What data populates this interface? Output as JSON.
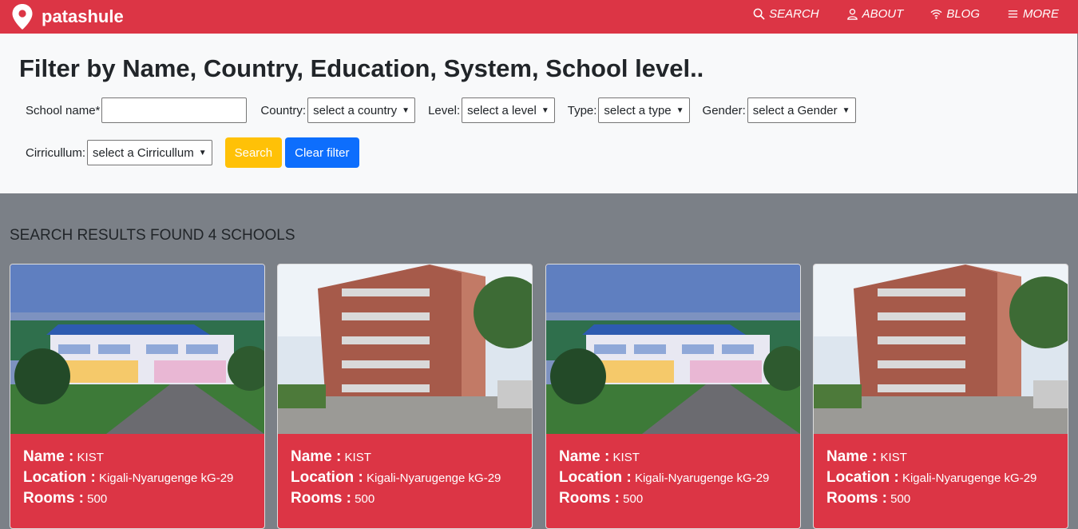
{
  "navbar": {
    "brand": "patashule",
    "links": [
      {
        "label": "SEARCH",
        "icon": "search-icon"
      },
      {
        "label": "ABOUT",
        "icon": "user-icon"
      },
      {
        "label": "BLOG",
        "icon": "wifi-icon"
      },
      {
        "label": "MORE",
        "icon": "menu-icon"
      }
    ]
  },
  "filter": {
    "title": "Filter by Name, Country, Education, System, School level..",
    "school_name_label": "School name*",
    "school_name_value": "",
    "country_label": "Country:",
    "country_value": "select a country",
    "level_label": "Level:",
    "level_value": "select a level",
    "type_label": "Type:",
    "type_value": "select a type",
    "gender_label": "Gender:",
    "gender_value": "select a Gender",
    "curriculum_label": "Cirricullum:",
    "curriculum_value": "select a Cirricullum",
    "search_button": "Search",
    "clear_button": "Clear filter"
  },
  "results": {
    "heading": "SEARCH RESULTS FOUND 4 SCHOOLS",
    "cards": [
      {
        "name_label": "Name :",
        "name": "KIST",
        "location_label": "Location :",
        "location": "Kigali-Nyarugenge kG-29",
        "rooms_label": "Rooms :",
        "rooms": "500",
        "image": "campus-night-photo"
      },
      {
        "name_label": "Name :",
        "name": "KIST",
        "location_label": "Location :",
        "location": "Kigali-Nyarugenge kG-29",
        "rooms_label": "Rooms :",
        "rooms": "500",
        "image": "building-photo"
      },
      {
        "name_label": "Name :",
        "name": "KIST",
        "location_label": "Location :",
        "location": "Kigali-Nyarugenge kG-29",
        "rooms_label": "Rooms :",
        "rooms": "500",
        "image": "campus-night-photo"
      },
      {
        "name_label": "Name :",
        "name": "KIST",
        "location_label": "Location :",
        "location": "Kigali-Nyarugenge kG-29",
        "rooms_label": "Rooms :",
        "rooms": "500",
        "image": "building-photo"
      }
    ]
  },
  "colors": {
    "brand": "#dc3545",
    "panel": "#f8f9fa",
    "results_bg": "#7b8087",
    "search_btn": "#ffc107",
    "clear_btn": "#0d6efd"
  }
}
